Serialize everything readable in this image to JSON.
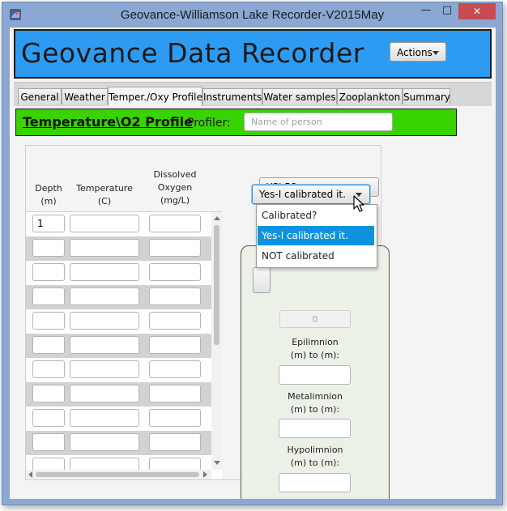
{
  "window": {
    "title": "Geovance-Williamson Lake Recorder-V2015May",
    "minimize_glyph": "—",
    "maximize_glyph": "□",
    "close_glyph": "✕"
  },
  "header": {
    "app_title": "Geovance Data Recorder",
    "actions_label": "Actions"
  },
  "tabs": [
    {
      "label": "General"
    },
    {
      "label": "Weather"
    },
    {
      "label": "Temper./Oxy Profile",
      "active": true
    },
    {
      "label": "Instruments"
    },
    {
      "label": "Water samples"
    },
    {
      "label": "Zooplankton"
    },
    {
      "label": "Summary"
    }
  ],
  "section": {
    "title": "Temperature\\O2 Profile",
    "profiler_label": "Profiler:",
    "profiler_placeholder": "Name of person",
    "profiler_value": ""
  },
  "table": {
    "headers": {
      "depth": [
        "Depth",
        "(m)"
      ],
      "temperature": [
        "Temperature",
        "(C)"
      ],
      "oxygen": [
        "Dissolved",
        "Oxygen",
        "(mg/L)"
      ]
    },
    "rows": [
      {
        "depth": "1",
        "temperature": "",
        "oxygen": ""
      },
      {
        "depth": "",
        "temperature": "",
        "oxygen": ""
      },
      {
        "depth": "",
        "temperature": "",
        "oxygen": ""
      },
      {
        "depth": "",
        "temperature": "",
        "oxygen": ""
      },
      {
        "depth": "",
        "temperature": "",
        "oxygen": ""
      },
      {
        "depth": "",
        "temperature": "",
        "oxygen": ""
      },
      {
        "depth": "",
        "temperature": "",
        "oxygen": ""
      },
      {
        "depth": "",
        "temperature": "",
        "oxygen": ""
      },
      {
        "depth": "",
        "temperature": "",
        "oxygen": ""
      },
      {
        "depth": "",
        "temperature": "",
        "oxygen": ""
      },
      {
        "depth": "",
        "temperature": "",
        "oxygen": ""
      }
    ]
  },
  "instrument": {
    "selected": "YSI 58"
  },
  "calibration": {
    "selected": "Yes-I calibrated it.",
    "options": [
      "Calibrated?",
      "Yes-I calibrated it.",
      "NOT calibrated"
    ],
    "highlighted_index": 1
  },
  "layers": {
    "count_value": "0",
    "epilimnion": [
      "Epilimnion",
      "(m) to (m):"
    ],
    "metalimnion": [
      "Metalimnion",
      "(m) to (m):"
    ],
    "hypolimnion": [
      "Hypolimnion",
      "(m) to (m):"
    ]
  },
  "colors": {
    "header_bg": "#2e9bf2",
    "section_bg": "#38d300",
    "selection": "#0d93de",
    "close_button": "#c74b50"
  }
}
